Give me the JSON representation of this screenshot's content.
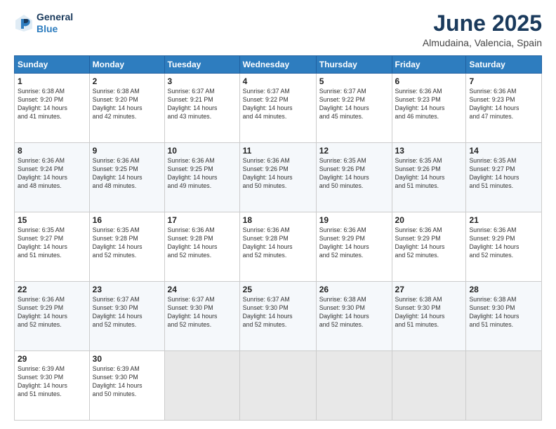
{
  "header": {
    "logo_line1": "General",
    "logo_line2": "Blue",
    "month": "June 2025",
    "location": "Almudaina, Valencia, Spain"
  },
  "weekdays": [
    "Sunday",
    "Monday",
    "Tuesday",
    "Wednesday",
    "Thursday",
    "Friday",
    "Saturday"
  ],
  "weeks": [
    [
      {
        "day": "1",
        "info": "Sunrise: 6:38 AM\nSunset: 9:20 PM\nDaylight: 14 hours\nand 41 minutes."
      },
      {
        "day": "2",
        "info": "Sunrise: 6:38 AM\nSunset: 9:20 PM\nDaylight: 14 hours\nand 42 minutes."
      },
      {
        "day": "3",
        "info": "Sunrise: 6:37 AM\nSunset: 9:21 PM\nDaylight: 14 hours\nand 43 minutes."
      },
      {
        "day": "4",
        "info": "Sunrise: 6:37 AM\nSunset: 9:22 PM\nDaylight: 14 hours\nand 44 minutes."
      },
      {
        "day": "5",
        "info": "Sunrise: 6:37 AM\nSunset: 9:22 PM\nDaylight: 14 hours\nand 45 minutes."
      },
      {
        "day": "6",
        "info": "Sunrise: 6:36 AM\nSunset: 9:23 PM\nDaylight: 14 hours\nand 46 minutes."
      },
      {
        "day": "7",
        "info": "Sunrise: 6:36 AM\nSunset: 9:23 PM\nDaylight: 14 hours\nand 47 minutes."
      }
    ],
    [
      {
        "day": "8",
        "info": "Sunrise: 6:36 AM\nSunset: 9:24 PM\nDaylight: 14 hours\nand 48 minutes."
      },
      {
        "day": "9",
        "info": "Sunrise: 6:36 AM\nSunset: 9:25 PM\nDaylight: 14 hours\nand 48 minutes."
      },
      {
        "day": "10",
        "info": "Sunrise: 6:36 AM\nSunset: 9:25 PM\nDaylight: 14 hours\nand 49 minutes."
      },
      {
        "day": "11",
        "info": "Sunrise: 6:36 AM\nSunset: 9:26 PM\nDaylight: 14 hours\nand 50 minutes."
      },
      {
        "day": "12",
        "info": "Sunrise: 6:35 AM\nSunset: 9:26 PM\nDaylight: 14 hours\nand 50 minutes."
      },
      {
        "day": "13",
        "info": "Sunrise: 6:35 AM\nSunset: 9:26 PM\nDaylight: 14 hours\nand 51 minutes."
      },
      {
        "day": "14",
        "info": "Sunrise: 6:35 AM\nSunset: 9:27 PM\nDaylight: 14 hours\nand 51 minutes."
      }
    ],
    [
      {
        "day": "15",
        "info": "Sunrise: 6:35 AM\nSunset: 9:27 PM\nDaylight: 14 hours\nand 51 minutes."
      },
      {
        "day": "16",
        "info": "Sunrise: 6:35 AM\nSunset: 9:28 PM\nDaylight: 14 hours\nand 52 minutes."
      },
      {
        "day": "17",
        "info": "Sunrise: 6:36 AM\nSunset: 9:28 PM\nDaylight: 14 hours\nand 52 minutes."
      },
      {
        "day": "18",
        "info": "Sunrise: 6:36 AM\nSunset: 9:28 PM\nDaylight: 14 hours\nand 52 minutes."
      },
      {
        "day": "19",
        "info": "Sunrise: 6:36 AM\nSunset: 9:29 PM\nDaylight: 14 hours\nand 52 minutes."
      },
      {
        "day": "20",
        "info": "Sunrise: 6:36 AM\nSunset: 9:29 PM\nDaylight: 14 hours\nand 52 minutes."
      },
      {
        "day": "21",
        "info": "Sunrise: 6:36 AM\nSunset: 9:29 PM\nDaylight: 14 hours\nand 52 minutes."
      }
    ],
    [
      {
        "day": "22",
        "info": "Sunrise: 6:36 AM\nSunset: 9:29 PM\nDaylight: 14 hours\nand 52 minutes."
      },
      {
        "day": "23",
        "info": "Sunrise: 6:37 AM\nSunset: 9:30 PM\nDaylight: 14 hours\nand 52 minutes."
      },
      {
        "day": "24",
        "info": "Sunrise: 6:37 AM\nSunset: 9:30 PM\nDaylight: 14 hours\nand 52 minutes."
      },
      {
        "day": "25",
        "info": "Sunrise: 6:37 AM\nSunset: 9:30 PM\nDaylight: 14 hours\nand 52 minutes."
      },
      {
        "day": "26",
        "info": "Sunrise: 6:38 AM\nSunset: 9:30 PM\nDaylight: 14 hours\nand 52 minutes."
      },
      {
        "day": "27",
        "info": "Sunrise: 6:38 AM\nSunset: 9:30 PM\nDaylight: 14 hours\nand 51 minutes."
      },
      {
        "day": "28",
        "info": "Sunrise: 6:38 AM\nSunset: 9:30 PM\nDaylight: 14 hours\nand 51 minutes."
      }
    ],
    [
      {
        "day": "29",
        "info": "Sunrise: 6:39 AM\nSunset: 9:30 PM\nDaylight: 14 hours\nand 51 minutes."
      },
      {
        "day": "30",
        "info": "Sunrise: 6:39 AM\nSunset: 9:30 PM\nDaylight: 14 hours\nand 50 minutes."
      },
      {
        "day": "",
        "info": ""
      },
      {
        "day": "",
        "info": ""
      },
      {
        "day": "",
        "info": ""
      },
      {
        "day": "",
        "info": ""
      },
      {
        "day": "",
        "info": ""
      }
    ]
  ]
}
